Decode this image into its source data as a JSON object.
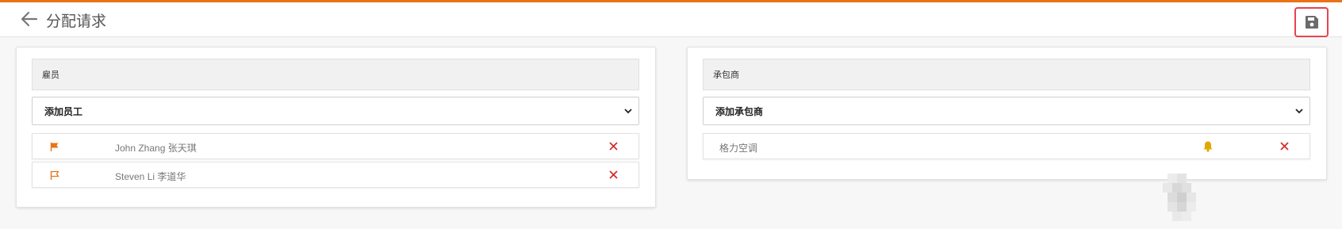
{
  "header": {
    "title": "分配请求",
    "back_icon": "arrow-left-icon",
    "save_icon": "floppy-disk-icon"
  },
  "employees": {
    "section_title": "雇员",
    "add_select": {
      "selected": "添加员工"
    },
    "items": [
      {
        "name": "John Zhang 张天琪",
        "flag": "flag-filled-icon"
      },
      {
        "name": "Steven Li 李道华",
        "flag": "flag-outline-icon"
      }
    ]
  },
  "contractors": {
    "section_title": "承包商",
    "add_select": {
      "selected": "添加承包商"
    },
    "items": [
      {
        "name": "格力空调",
        "status_icon": "bell-icon"
      }
    ]
  },
  "colors": {
    "accent": "#e8731a",
    "delete": "#d32f2f",
    "bell": "#e0a800",
    "save_highlight": "#e8434f"
  }
}
